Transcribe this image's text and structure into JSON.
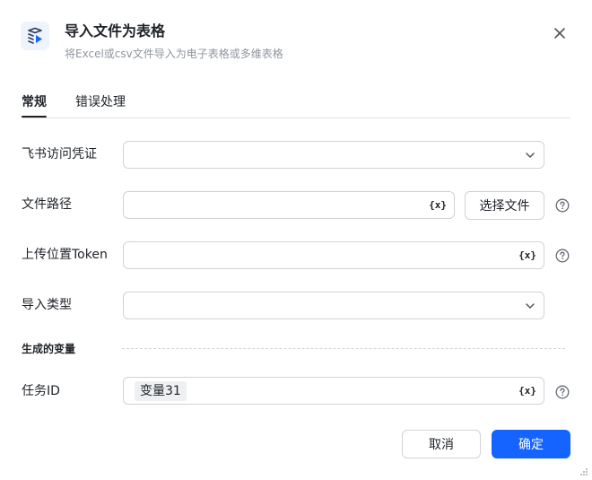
{
  "header": {
    "title": "导入文件为表格",
    "subtitle": "将Excel或csv文件导入为电子表格或多维表格",
    "icon": "import-table-icon",
    "close_icon": "close-icon"
  },
  "tabs": [
    {
      "label": "常规",
      "active": true
    },
    {
      "label": "错误处理",
      "active": false
    }
  ],
  "form": {
    "credential": {
      "label": "飞书访问凭证",
      "value": ""
    },
    "file_path": {
      "label": "文件路径",
      "value": "",
      "var_symbol": "{x}",
      "button_label": "选择文件"
    },
    "upload_token": {
      "label": "上传位置Token",
      "value": "",
      "var_symbol": "{x}"
    },
    "import_type": {
      "label": "导入类型",
      "value": ""
    }
  },
  "generated_vars": {
    "section_title": "生成的变量",
    "task_id": {
      "label": "任务ID",
      "value": "变量31",
      "var_symbol": "{x}"
    }
  },
  "footer": {
    "cancel_label": "取消",
    "ok_label": "确定"
  },
  "colors": {
    "primary": "#1664ff",
    "text": "#1f2329",
    "muted": "#8f959e",
    "border": "#d0d3d6"
  }
}
